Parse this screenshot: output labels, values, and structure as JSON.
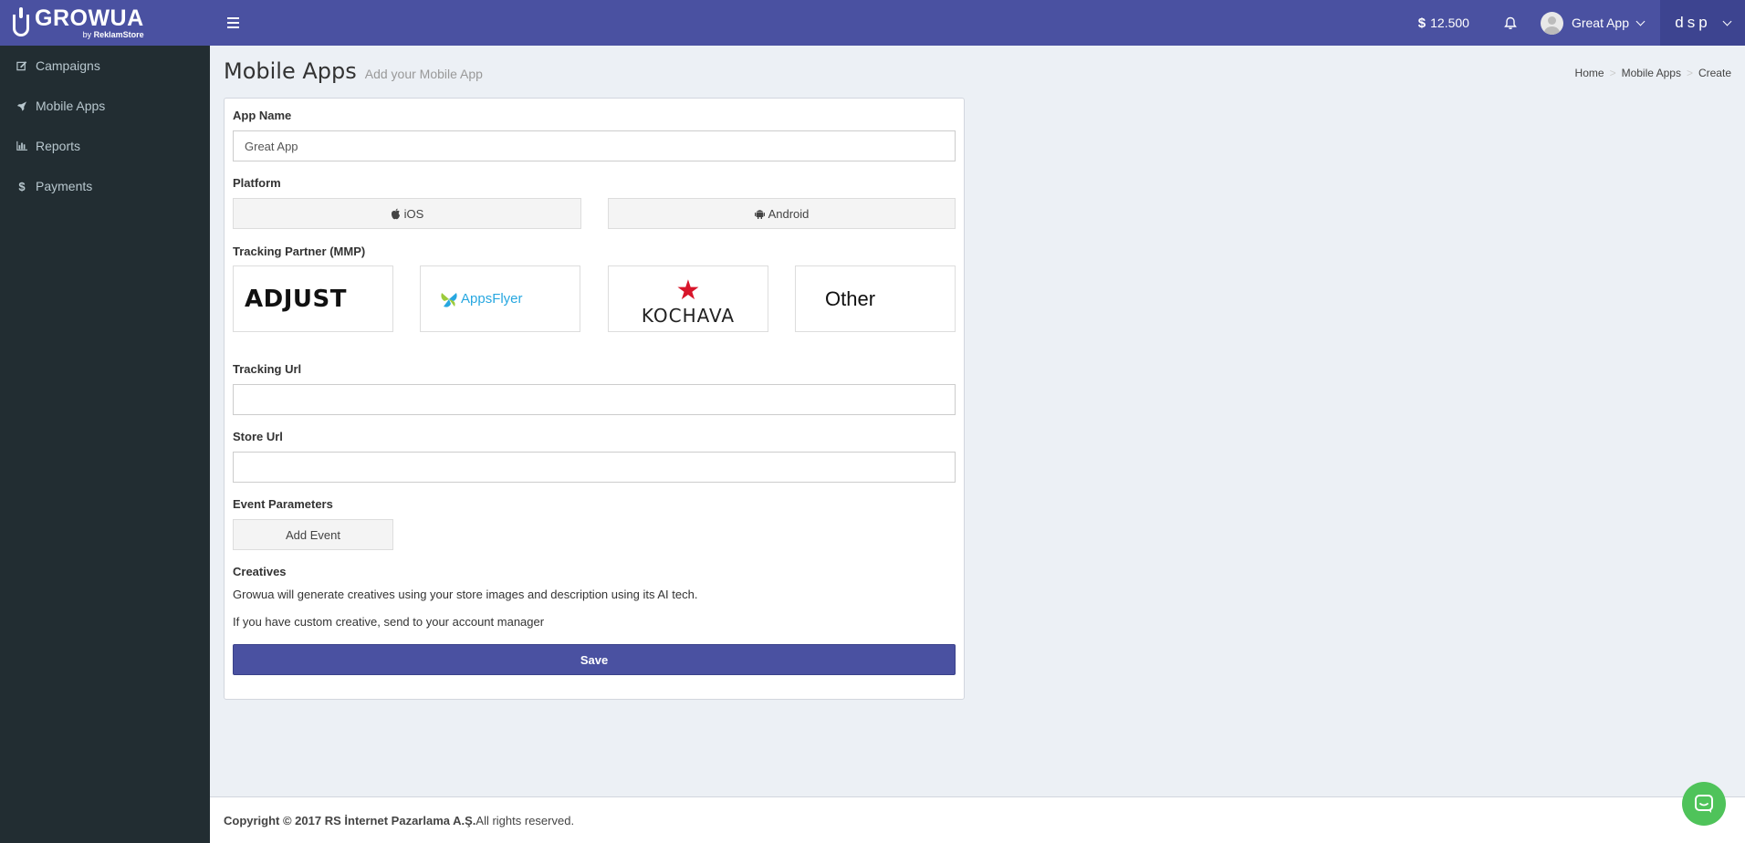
{
  "header": {
    "logo_name": "GROWUA",
    "logo_sub_prefix": "by",
    "logo_sub_brand": "ReklamStore",
    "balance_symbol": "$",
    "balance_value": "12.500",
    "user_name": "Great App",
    "dsp_label": "dsp"
  },
  "sidebar": {
    "items": [
      {
        "label": "Campaigns",
        "icon": "edit-icon"
      },
      {
        "label": "Mobile Apps",
        "icon": "rocket-icon"
      },
      {
        "label": "Reports",
        "icon": "bar-chart-icon"
      },
      {
        "label": "Payments",
        "icon": "dollar-icon"
      }
    ]
  },
  "page": {
    "title": "Mobile Apps",
    "subtitle": "Add your Mobile App",
    "breadcrumb": [
      "Home",
      "Mobile Apps",
      "Create"
    ]
  },
  "form": {
    "app_name_label": "App Name",
    "app_name_value": "Great App",
    "platform_label": "Platform",
    "platform_ios": "iOS",
    "platform_android": "Android",
    "tracking_partner_label": "Tracking Partner (MMP)",
    "mmp_adjust": "ADJUST",
    "mmp_appsflyer": "AppsFlyer",
    "mmp_kochava": "KOCHAVA",
    "mmp_other": "Other",
    "tracking_url_label": "Tracking Url",
    "tracking_url_value": "",
    "store_url_label": "Store Url",
    "store_url_value": "",
    "event_params_label": "Event Parameters",
    "add_event_label": "Add Event",
    "creatives_label": "Creatives",
    "creatives_text_1": "Growua will generate creatives using your store images and description using its AI tech.",
    "creatives_text_2": "If you have custom creative, send to your account manager",
    "save_label": "Save"
  },
  "footer": {
    "copyright_bold": "Copyright © 2017 RS İnternet Pazarlama A.Ş.",
    "copyright_rest": " All rights reserved."
  },
  "colors": {
    "header_bg": "#4a51a1",
    "sidebar_bg": "#222d32",
    "save_button": "#4a51a1",
    "chat_button": "#4fc35a",
    "kochava_star": "#d8152a",
    "appsflyer_blue": "#27a7e0"
  }
}
